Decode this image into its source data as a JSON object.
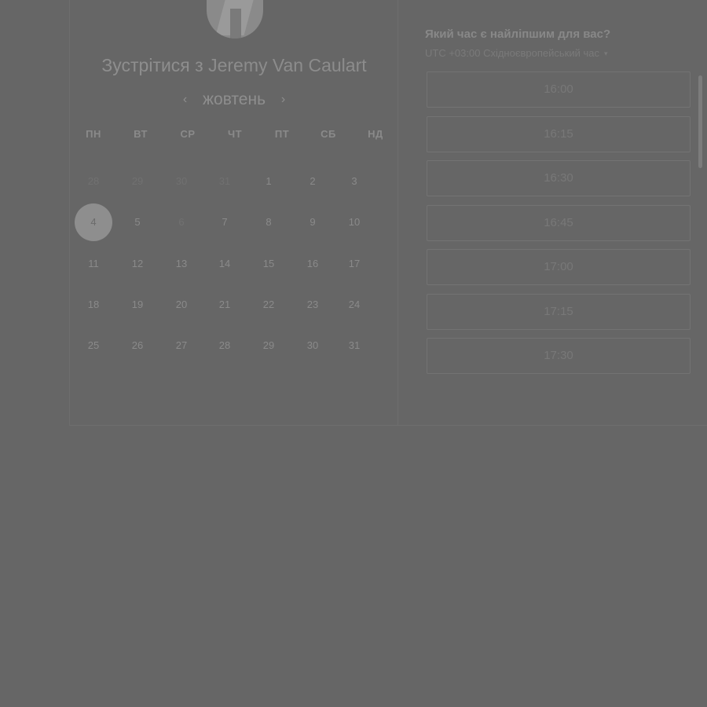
{
  "header": {
    "title_prefix": "Зустрітися з",
    "host_name": "Jeremy Van Caulart"
  },
  "calendar": {
    "month": "жовтень",
    "prev_icon": "‹",
    "next_icon": "›",
    "weekdays": [
      "ПН",
      "ВТ",
      "СР",
      "ЧТ",
      "ПТ",
      "СБ",
      "НД"
    ],
    "weeks": [
      [
        "28",
        "29",
        "30",
        "31",
        "1",
        "2",
        "3"
      ],
      [
        "4",
        "5",
        "6",
        "7",
        "8",
        "9",
        "10"
      ],
      [
        "11",
        "12",
        "13",
        "14",
        "15",
        "16",
        "17"
      ],
      [
        "18",
        "19",
        "20",
        "21",
        "22",
        "23",
        "24"
      ],
      [
        "25",
        "26",
        "27",
        "28",
        "29",
        "30",
        "31"
      ]
    ],
    "selected_day": "4"
  },
  "schedule": {
    "question": "Який час є найліпшим для вас?",
    "timezone": "UTC +03:00 Східноєвропейський час",
    "caret": "▾",
    "slots": [
      "16:00",
      "16:15",
      "16:30",
      "16:45",
      "17:00",
      "17:15",
      "17:30"
    ]
  },
  "colors": {
    "overlay_background": "#666666",
    "selected_day_fill": "#8e8e8e"
  }
}
